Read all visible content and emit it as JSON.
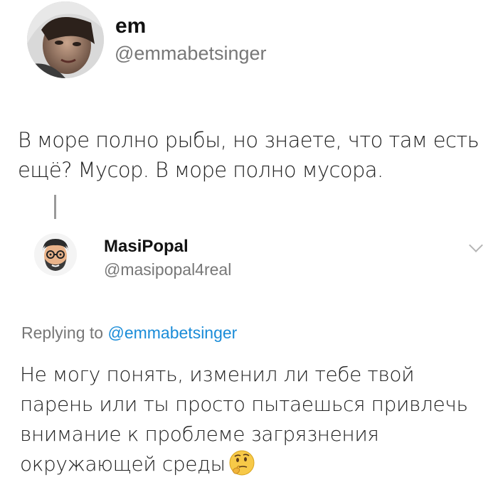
{
  "tweet": {
    "author_name": "em",
    "author_handle": "@emmabetsinger",
    "text": "В море полно рыбы, но знаете, что там есть ещё? Мусор. В море полно мусора."
  },
  "reply": {
    "author_name": "MasiPopal",
    "author_handle": "@masipopal4real",
    "replying_prefix": "Replying to",
    "replying_mention": "@emmabetsinger",
    "text": "Не могу понять, изменил ли тебе твой парень или ты просто пытаешься привлечь внимание к проблеме загрязнения окружающей среды",
    "emoji": "thinking-face-icon"
  },
  "colors": {
    "mention": "#1a8cd8",
    "handle": "#777777",
    "text": "#222222"
  }
}
